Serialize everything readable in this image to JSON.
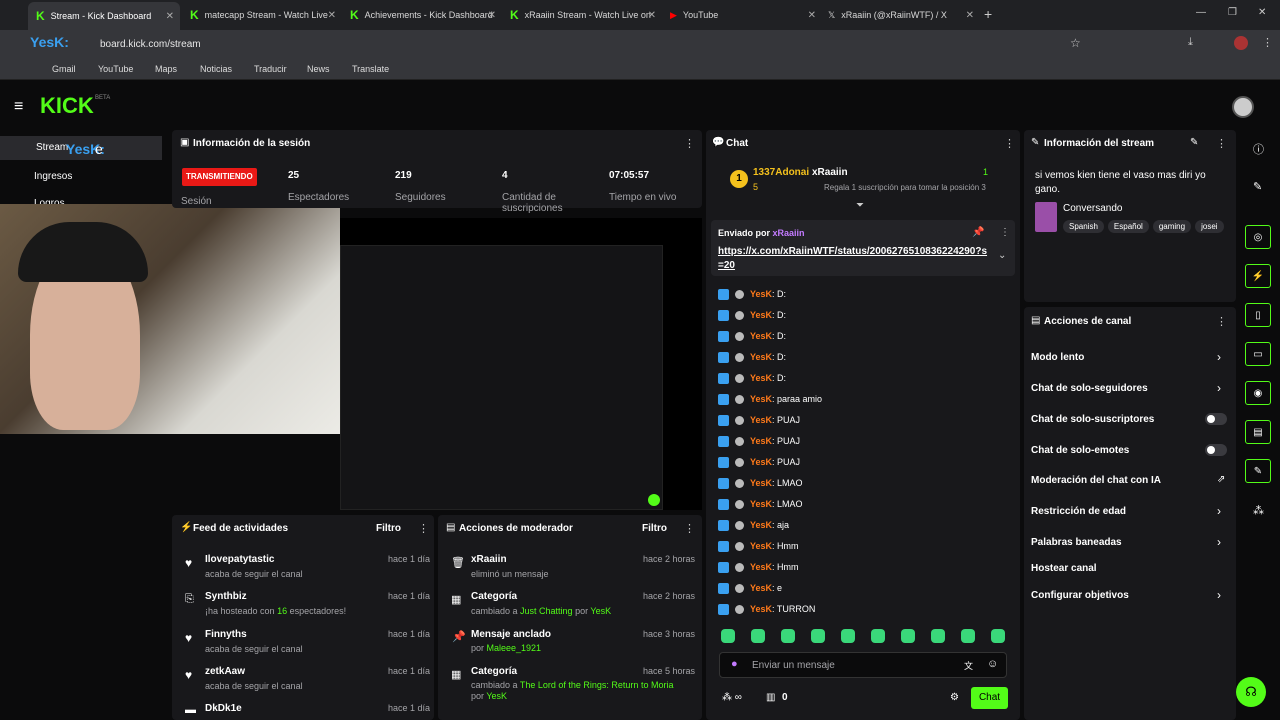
{
  "browser": {
    "tabs": [
      {
        "title": "Stream - Kick Dashboard"
      },
      {
        "title": "matecapp Stream - Watch Live"
      },
      {
        "title": "Achievements - Kick Dashboard"
      },
      {
        "title": "xRaaiin Stream - Watch Live on"
      },
      {
        "title": "YouTube"
      },
      {
        "title": "xRaaiin (@xRaiinWTF) / X"
      }
    ],
    "address": "board.kick.com/stream",
    "bookmarks": [
      "Gmail",
      "YouTube",
      "Maps",
      "Noticias",
      "Traducir",
      "News",
      "Translate"
    ]
  },
  "overlay": {
    "kick_logo": "KICK",
    "beta": "BETA",
    "yesk": "YesK:",
    "letter_e": "e",
    "stream": "Stream",
    "ingresos": "Ingresos",
    "logros": "Logros"
  },
  "session": {
    "title": "Información de la sesión",
    "status": "TRANSMITIENDO",
    "status_label": "Sesión",
    "viewers": "25",
    "viewers_label": "Espectadores",
    "followers": "219",
    "followers_label": "Seguidores",
    "subs": "4",
    "subs_label": "Cantidad de suscripciones",
    "uptime": "07:05:57",
    "uptime_label": "Tiempo en vivo"
  },
  "feed": {
    "title": "Feed de actividades",
    "filter": "Filtro",
    "items": [
      {
        "user": "Ilovepatytastic",
        "desc": "acaba de seguir el canal",
        "time": "hace 1 día"
      },
      {
        "user": "Synthbiz",
        "desc_pre": "¡ha hosteado con ",
        "desc_num": "16",
        "desc_post": " espectadores!",
        "time": "hace 1 día"
      },
      {
        "user": "Finnyths",
        "desc": "acaba de seguir el canal",
        "time": "hace 1 día"
      },
      {
        "user": "zetkAaw",
        "desc": "acaba de seguir el canal",
        "time": "hace 1 día"
      },
      {
        "user": "DkDk1e",
        "time": "hace 1 día"
      }
    ]
  },
  "mod": {
    "title": "Acciones de moderador",
    "filter": "Filtro",
    "items": [
      {
        "title": "xRaaiin",
        "desc": "eliminó un mensaje",
        "time": "hace 2 horas"
      },
      {
        "title": "Categoría",
        "desc_pre": "cambiado a ",
        "desc_link": "Just Chatting",
        "desc_mid": " por ",
        "desc_user": "YesK",
        "time": "hace 2 horas"
      },
      {
        "title": "Mensaje anclado",
        "desc_pre": "por ",
        "desc_user": "Maleee_1921",
        "time": "hace 3 horas"
      },
      {
        "title": "Categoría",
        "desc_pre": "cambiado a ",
        "desc_link": "The Lord of the Rings: Return to Moria",
        "desc_mid": " por ",
        "desc_user": "YesK",
        "time": "hace 5 horas"
      }
    ]
  },
  "chat": {
    "title": "Chat",
    "top_user": "1337Adonai",
    "top_rank": "1",
    "top_count": "5",
    "gift_user": "xRaaiin",
    "gift_text": "Regala 1 suscripción para tomar la posición 3",
    "gift_rank": "1",
    "pinned_label": "Enviado por",
    "pinned_user": "xRaaiin",
    "pinned_link": "https://x.com/xRaiinWTF/status/2006276510836224290?s=20",
    "messages": [
      {
        "user": "YesK",
        "text": ": D:"
      },
      {
        "user": "YesK",
        "text": ": D:"
      },
      {
        "user": "YesK",
        "text": ": D:"
      },
      {
        "user": "YesK",
        "text": ": D:"
      },
      {
        "user": "YesK",
        "text": ": D:"
      },
      {
        "user": "YesK",
        "text": ": paraa amio"
      },
      {
        "user": "YesK",
        "text": ": PUAJ"
      },
      {
        "user": "YesK",
        "text": ": PUAJ"
      },
      {
        "user": "YesK",
        "text": ": PUAJ"
      },
      {
        "user": "YesK",
        "text": ": LMAO"
      },
      {
        "user": "YesK",
        "text": ": LMAO"
      },
      {
        "user": "YesK",
        "text": ": aja"
      },
      {
        "user": "YesK",
        "text": ": Hmm"
      },
      {
        "user": "YesK",
        "text": ": Hmm"
      },
      {
        "user": "YesK",
        "text": ": e"
      },
      {
        "user": "YesK",
        "text": ": TURRON"
      }
    ],
    "input_placeholder": "Enviar un mensaje",
    "count": "0",
    "send": "Chat"
  },
  "stream_info": {
    "title": "Información del stream",
    "desc": "si vemos kien tiene el vaso mas diri yo gano.",
    "category": "Conversando",
    "tags": [
      "Spanish",
      "Español",
      "gaming",
      "josei"
    ]
  },
  "actions": {
    "title": "Acciones de canal",
    "items": [
      "Modo lento",
      "Chat de solo-seguidores",
      "Chat de solo-suscriptores",
      "Chat de solo-emotes",
      "Moderación del chat con IA",
      "Restricción de edad",
      "Palabras baneadas",
      "Hostear canal",
      "Configurar objetivos"
    ]
  },
  "colors": {
    "accent": "#53fc18",
    "live_red": "#e91916",
    "chat_user": "#ff7a1a"
  }
}
